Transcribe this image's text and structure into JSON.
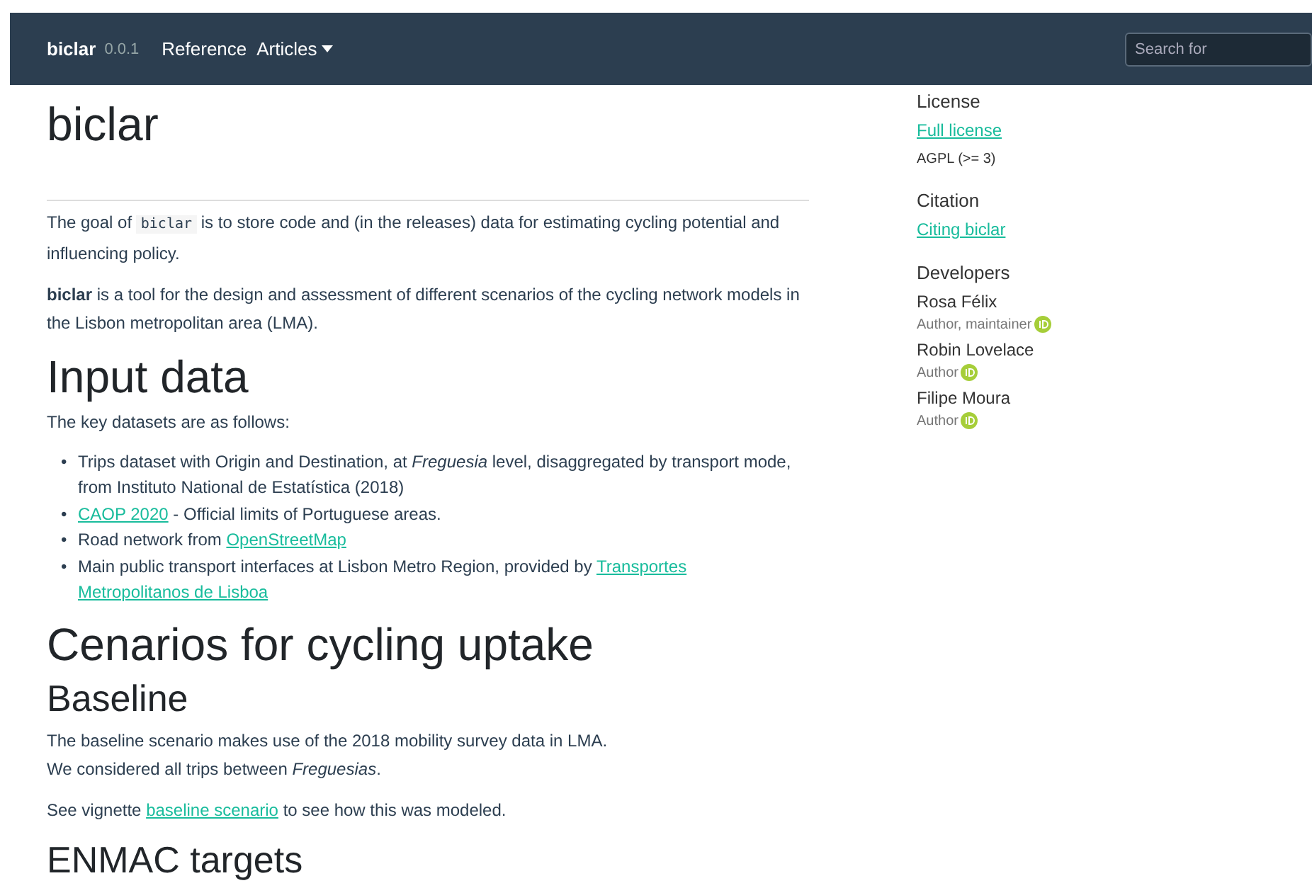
{
  "navbar": {
    "brand": "biclar",
    "version": "0.0.1",
    "links": [
      {
        "label": "Reference",
        "kind": "link"
      },
      {
        "label": "Articles",
        "kind": "dropdown"
      }
    ],
    "search": {
      "placeholder": "Search for"
    }
  },
  "main": [
    {
      "kind": "h1",
      "text": "biclar"
    },
    {
      "kind": "hr"
    },
    {
      "kind": "p",
      "segments": [
        {
          "kind": "text",
          "text": "The goal of"
        },
        {
          "kind": "code",
          "text": "biclar"
        },
        {
          "kind": "text",
          "text": "is to store code and (in the releases) data for estimating cycling potential and influencing policy."
        }
      ]
    },
    {
      "kind": "p",
      "segments": [
        {
          "kind": "text",
          "text": "**biclar** is a tool for the design and assessment of different scenarios of the cycling network models in the Lisbon metropolitan area (LMA)."
        }
      ]
    },
    {
      "kind": "h2",
      "text": "Input data"
    },
    {
      "kind": "p",
      "segments": [
        {
          "kind": "text",
          "text": "The key datasets are as follows:"
        }
      ]
    },
    {
      "kind": "ul",
      "items": [
        {
          "marker": "•",
          "segments": [
            {
              "kind": "text",
              "text": "Trips dataset with Origin and Destination, at *Freguesia* level, disaggregated by transport mode, from Instituto National de Estatística (2018)"
            }
          ]
        },
        {
          "marker": "•",
          "segments": [
            {
              "kind": "link",
              "text": "CAOP 2020"
            },
            {
              "kind": "text",
              "text": "- Official limits of Portuguese areas."
            }
          ]
        },
        {
          "marker": "•",
          "segments": [
            {
              "kind": "text",
              "text": "Road network from"
            },
            {
              "kind": "link",
              "text": "OpenStreetMap"
            }
          ]
        },
        {
          "marker": "•",
          "segments": [
            {
              "kind": "text",
              "text": "Main public transport interfaces at Lisbon Metro Region, provided by"
            },
            {
              "kind": "link",
              "text": "Transportes"
            },
            {
              "kind": "link",
              "text": "Metropolitanos de Lisboa"
            }
          ]
        }
      ]
    },
    {
      "kind": "h2",
      "text": "Cenarios for cycling uptake"
    },
    {
      "kind": "h3",
      "text": "Baseline"
    },
    {
      "kind": "p",
      "segments": [
        {
          "kind": "text",
          "text": "The baseline scenario makes use of the 2018 mobility survey data in LMA."
        },
        {
          "kind": "break"
        },
        {
          "kind": "text",
          "text": "We considered all trips between *Freguesias*."
        }
      ]
    },
    {
      "kind": "p",
      "segments": [
        {
          "kind": "text",
          "text": "See vignette"
        },
        {
          "kind": "link",
          "text": "baseline scenario"
        },
        {
          "kind": "text",
          "text": "to see how this was modeled."
        }
      ]
    },
    {
      "kind": "h3",
      "text": "ENMAC targets"
    }
  ],
  "sidebar": [
    {
      "heading": "License",
      "items": [
        {
          "kind": "link",
          "text": "Full license"
        },
        {
          "kind": "small",
          "text": "AGPL (>= 3)"
        }
      ]
    },
    {
      "heading": "Citation",
      "items": [
        {
          "kind": "link",
          "text": "Citing biclar"
        }
      ]
    },
    {
      "heading": "Developers",
      "items": [
        {
          "kind": "person",
          "name": "Rosa Félix",
          "role": "Author, maintainer"
        },
        {
          "kind": "person",
          "name": "Robin Lovelace",
          "role": "Author"
        },
        {
          "kind": "person",
          "name": "Filipe Moura",
          "role": "Author"
        }
      ]
    }
  ]
}
